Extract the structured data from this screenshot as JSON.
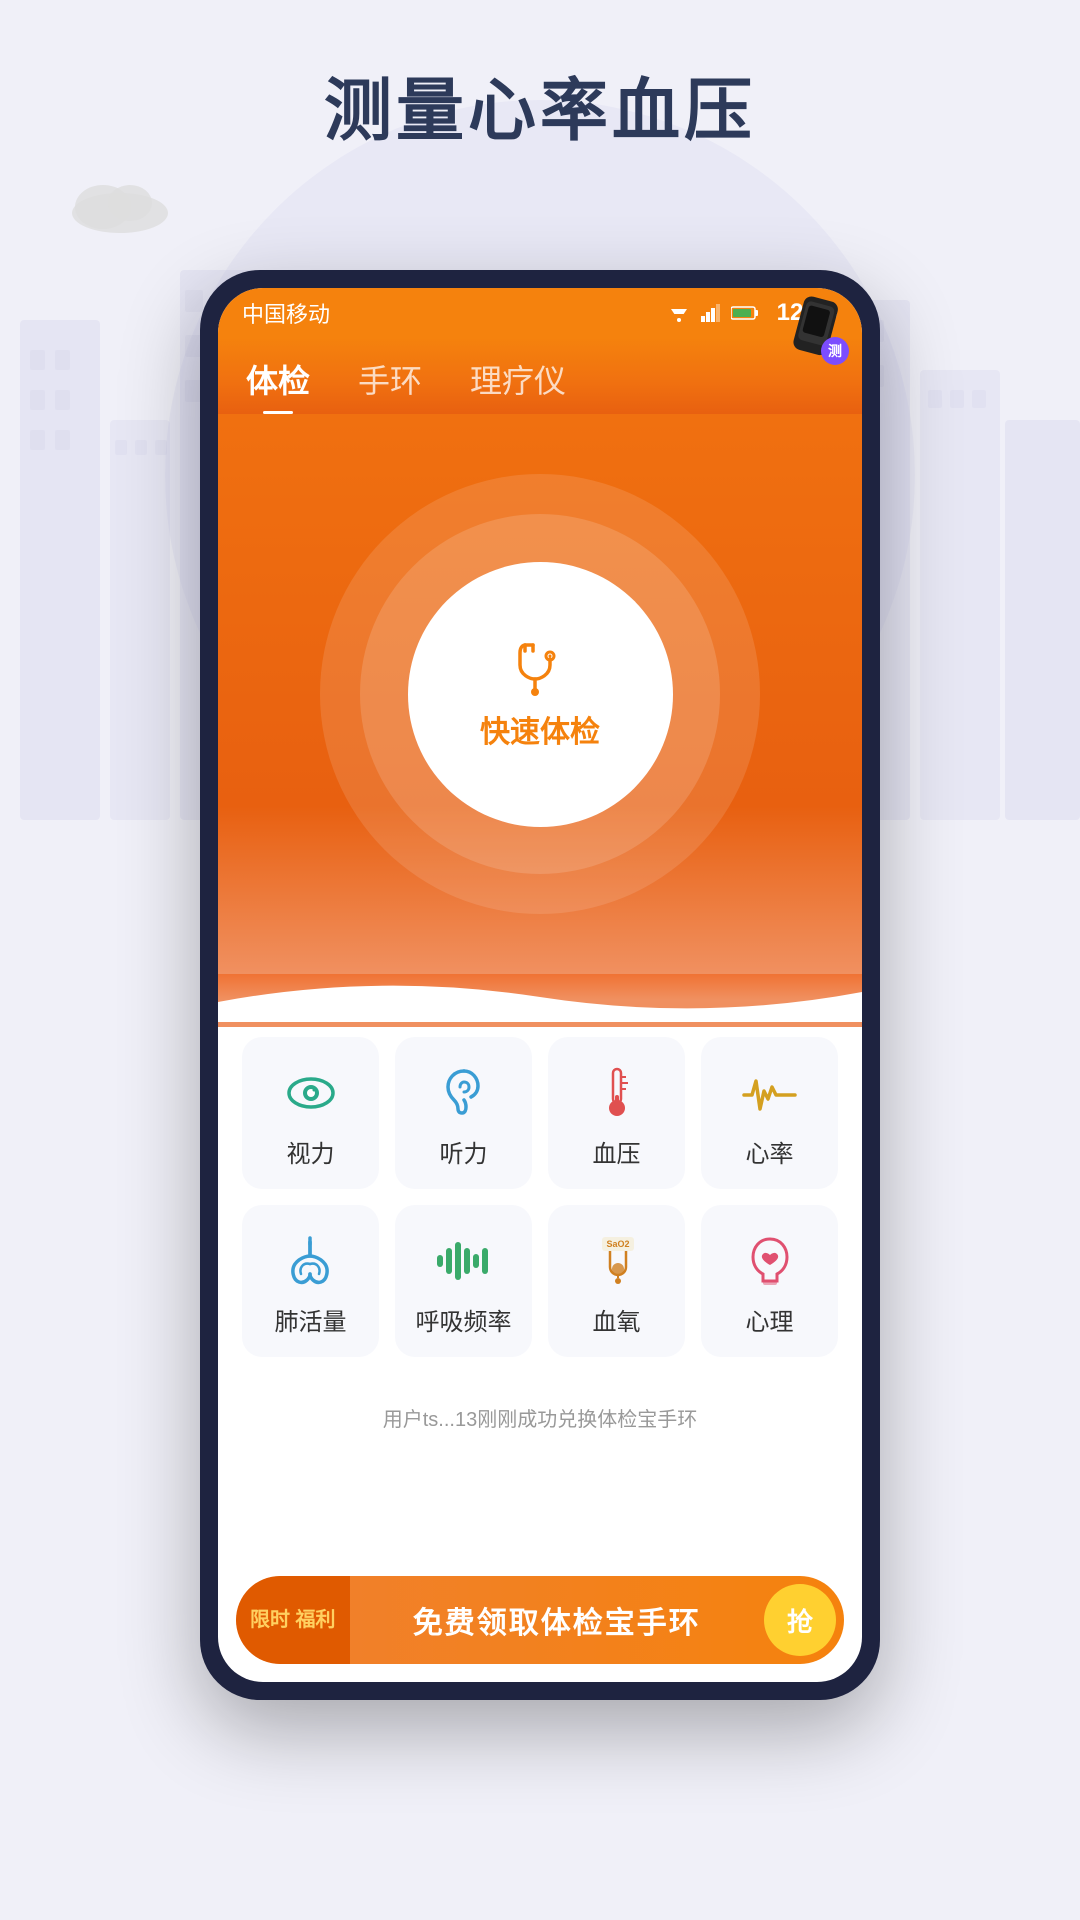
{
  "page": {
    "title": "测量心率血压",
    "background_color": "#f0f0f8"
  },
  "status_bar": {
    "carrier": "中国移动",
    "time": "12:30"
  },
  "nav_tabs": [
    {
      "label": "体检",
      "active": true
    },
    {
      "label": "手环",
      "active": false
    },
    {
      "label": "理疗仪",
      "active": false
    }
  ],
  "main_button": {
    "label": "快速体检"
  },
  "grid_items": [
    {
      "id": "vision",
      "label": "视力",
      "icon": "eye"
    },
    {
      "id": "hearing",
      "label": "听力",
      "icon": "ear"
    },
    {
      "id": "blood-pressure",
      "label": "血压",
      "icon": "thermometer"
    },
    {
      "id": "heart-rate",
      "label": "心率",
      "icon": "heartbeat"
    },
    {
      "id": "lung",
      "label": "肺活量",
      "icon": "lung"
    },
    {
      "id": "breath",
      "label": "呼吸频率",
      "icon": "breath"
    },
    {
      "id": "blood-oxygen",
      "label": "血氧",
      "icon": "tube"
    },
    {
      "id": "mental",
      "label": "心理",
      "icon": "head"
    }
  ],
  "ticker": {
    "text": "用户ts...13刚刚成功兑换体检宝手环"
  },
  "banner": {
    "tag": "限时\n福利",
    "text": "免费领取体检宝手环",
    "btn_label": "抢"
  },
  "band_badge": "测"
}
